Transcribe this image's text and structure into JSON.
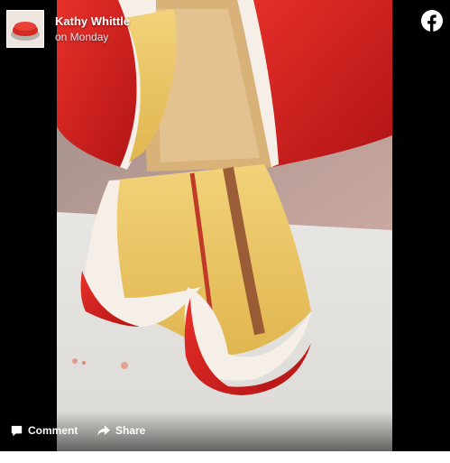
{
  "post": {
    "author": "Kathy Whittle",
    "time": "on Monday",
    "brand_color": "#1877f2"
  },
  "icons": {
    "brand": "facebook-icon",
    "comment": "comment-icon",
    "share": "share-icon"
  },
  "actions": {
    "comment_label": "Comment",
    "share_label": "Share"
  },
  "photo": {
    "subject": "cake-photo"
  }
}
